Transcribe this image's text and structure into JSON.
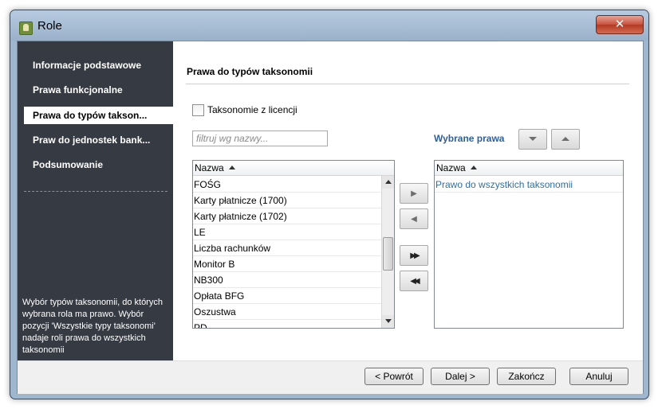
{
  "window": {
    "title": "Role",
    "close_label": "✕"
  },
  "sidebar": {
    "items": [
      {
        "label": "Informacje podstawowe"
      },
      {
        "label": "Prawa funkcjonalne"
      },
      {
        "label": "Prawa do typów takson..."
      },
      {
        "label": "Praw do jednostek bank..."
      },
      {
        "label": "Podsumowanie"
      }
    ],
    "active_index": 2,
    "description": "Wybór typów taksonomii, do których wybrana rola ma prawo. Wybór pozycji 'Wszystkie typy taksonomi' nadaje roli prawa do wszystkich taksonomii"
  },
  "main": {
    "heading": "Prawa do typów taksonomii",
    "licensed_checkbox": {
      "label": "Taksonomie z licencji",
      "checked": false
    },
    "filter": {
      "placeholder": "filtruj wg nazwy..."
    },
    "selected_title": "Wybrane prawa",
    "available_list": {
      "column": "Nazwa",
      "rows": [
        "FOŚG",
        "Karty płatnicze (1700)",
        "Karty płatnicze (1702)",
        "LE",
        "Liczba rachunków",
        "Monitor B",
        "NB300",
        "Opłata BFG",
        "Oszustwa",
        "PD"
      ]
    },
    "selected_list": {
      "column": "Nazwa",
      "rows": [
        "Prawo do wszystkich taksonomii"
      ]
    },
    "move_buttons": {
      "add": "▶",
      "remove": "◀",
      "add_all": "▶▶",
      "remove_all": "◀◀"
    }
  },
  "footer": {
    "back": "< Powrót",
    "next": "Dalej >",
    "finish": "Zakończ",
    "cancel": "Anuluj"
  },
  "colors": {
    "sidebar_bg": "#363a42",
    "accent_blue": "#2f5f9a",
    "selected_text": "#2f6fa5"
  }
}
